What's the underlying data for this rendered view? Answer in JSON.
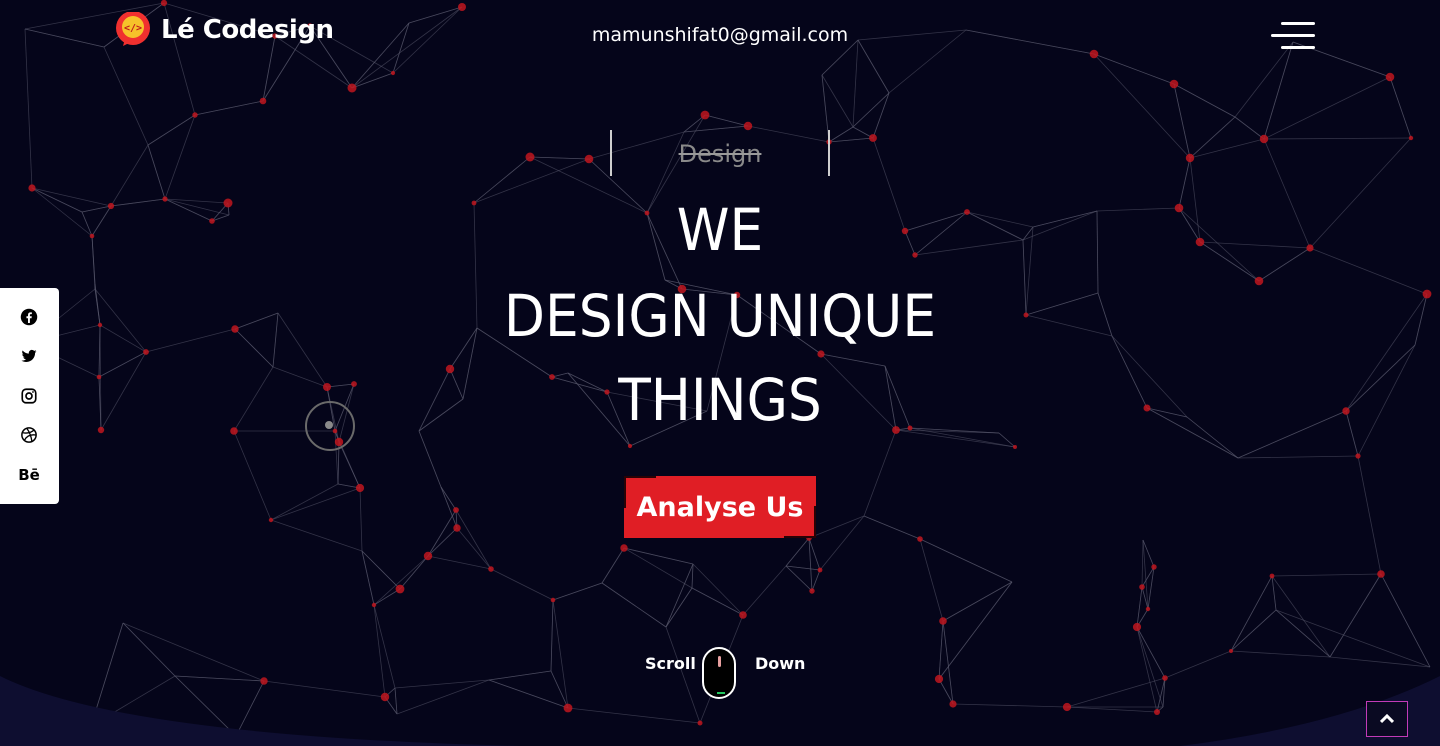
{
  "brand": {
    "name": "Lé Codesign",
    "logo_icon": "code-bubble-icon"
  },
  "header": {
    "email": "mamunshifat0@gmail.com",
    "menu_icon": "hamburger-menu-icon"
  },
  "social": [
    {
      "name": "facebook",
      "icon": "facebook-icon"
    },
    {
      "name": "twitter",
      "icon": "twitter-icon"
    },
    {
      "name": "instagram",
      "icon": "instagram-icon"
    },
    {
      "name": "dribbble",
      "icon": "dribbble-icon"
    },
    {
      "name": "behance",
      "icon": "behance-icon",
      "glyph": "Bē"
    }
  ],
  "hero": {
    "typed_word": "Design",
    "lines": [
      "WE",
      "DESIGN UNIQUE",
      "THINGS"
    ],
    "cta_label": "Analyse Us"
  },
  "scroll": {
    "left": "Scroll",
    "right": "Down"
  },
  "colors": {
    "background": "#05051a",
    "accent": "#e01e25",
    "node": "#c0161f",
    "line": "#5a5a6e",
    "to_top_border": "#c23bb8"
  }
}
